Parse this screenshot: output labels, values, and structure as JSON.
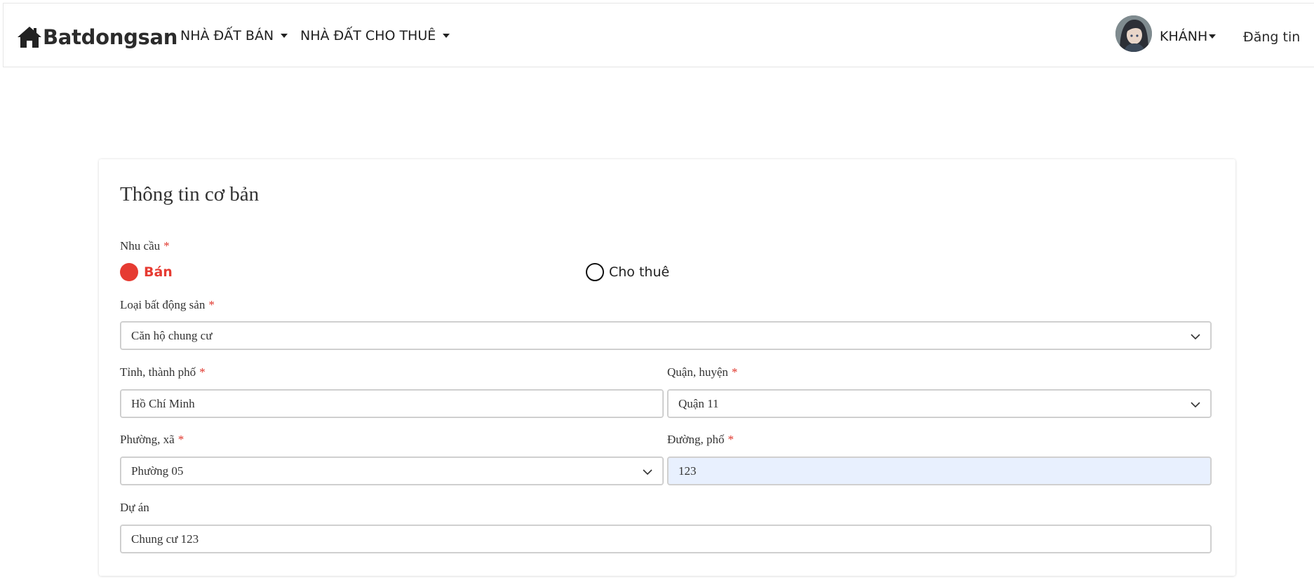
{
  "brand": {
    "name": "Batdongsan",
    "icon": "house-icon"
  },
  "nav": {
    "items": [
      {
        "label": "NHÀ ĐẤT BÁN"
      },
      {
        "label": "NHÀ ĐẤT CHO THUÊ"
      }
    ],
    "user": {
      "name": "KHÁNH",
      "avatar": "avatar"
    },
    "post_label": "Đăng tin"
  },
  "form": {
    "title": "Thông tin cơ bản",
    "required_mark": "*",
    "demand": {
      "label": "Nhu cầu",
      "options": [
        {
          "label": "Bán",
          "selected": true
        },
        {
          "label": "Cho thuê",
          "selected": false
        }
      ]
    },
    "property_type": {
      "label": "Loại bất động sản",
      "value": "Căn hộ chung cư"
    },
    "province": {
      "label": "Tỉnh, thành phố",
      "value": "Hồ Chí Minh"
    },
    "district": {
      "label": "Quận, huyện",
      "value": "Quận 11"
    },
    "ward": {
      "label": "Phường, xã",
      "value": "Phường 05"
    },
    "street": {
      "label": "Đường, phố",
      "value": "123"
    },
    "project": {
      "label": "Dự án",
      "value": "Chung cư 123"
    }
  },
  "colors": {
    "accent": "#e63b32",
    "autofill": "#e8f0fe",
    "text": "#333333"
  }
}
